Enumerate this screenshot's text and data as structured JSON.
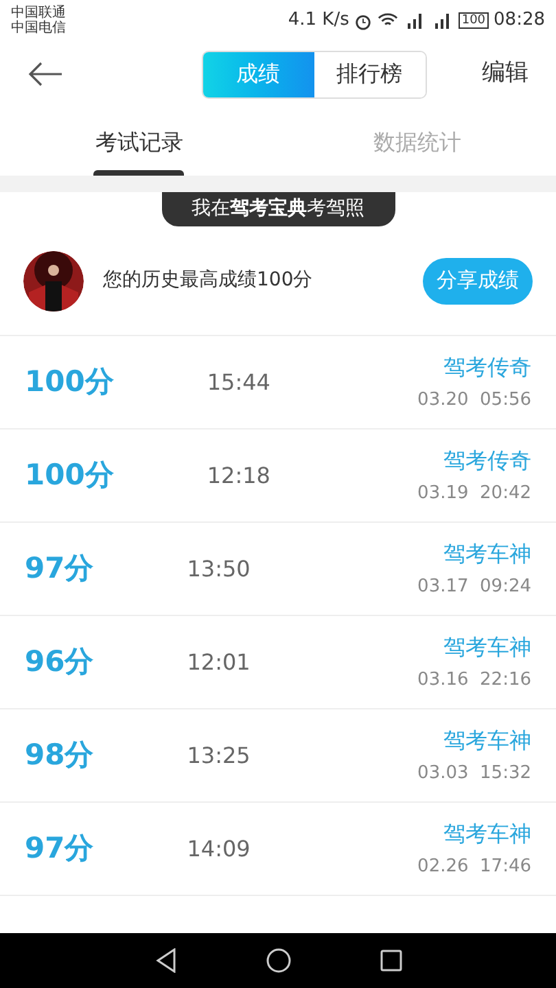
{
  "status_bar": {
    "carriers": [
      "中国联通",
      "中国电信"
    ],
    "speed": "4.1 K/s",
    "battery": "100",
    "time": "08:28"
  },
  "header": {
    "segments": [
      {
        "label": "成绩",
        "selected": true
      },
      {
        "label": "排行榜",
        "selected": false
      }
    ],
    "edit": "编辑"
  },
  "tabs": [
    {
      "label": "考试记录",
      "selected": true
    },
    {
      "label": "数据统计",
      "selected": false
    }
  ],
  "banner": "我在**驾考宝典**考驾照",
  "profile": {
    "text": "您的历史最高成绩100分",
    "share": "分享成绩"
  },
  "records": [
    {
      "score": "100分",
      "duration": "15:44",
      "title": "驾考传奇",
      "date": "03.20  05:56"
    },
    {
      "score": "100分",
      "duration": "12:18",
      "title": "驾考传奇",
      "date": "03.19  20:42"
    },
    {
      "score": "97分",
      "duration": "13:50",
      "title": "驾考车神",
      "date": "03.17  09:24"
    },
    {
      "score": "96分",
      "duration": "12:01",
      "title": "驾考车神",
      "date": "03.16  22:16"
    },
    {
      "score": "98分",
      "duration": "13:25",
      "title": "驾考车神",
      "date": "03.03  15:32"
    },
    {
      "score": "97分",
      "duration": "14:09",
      "title": "驾考车神",
      "date": "02.26  17:46"
    }
  ]
}
